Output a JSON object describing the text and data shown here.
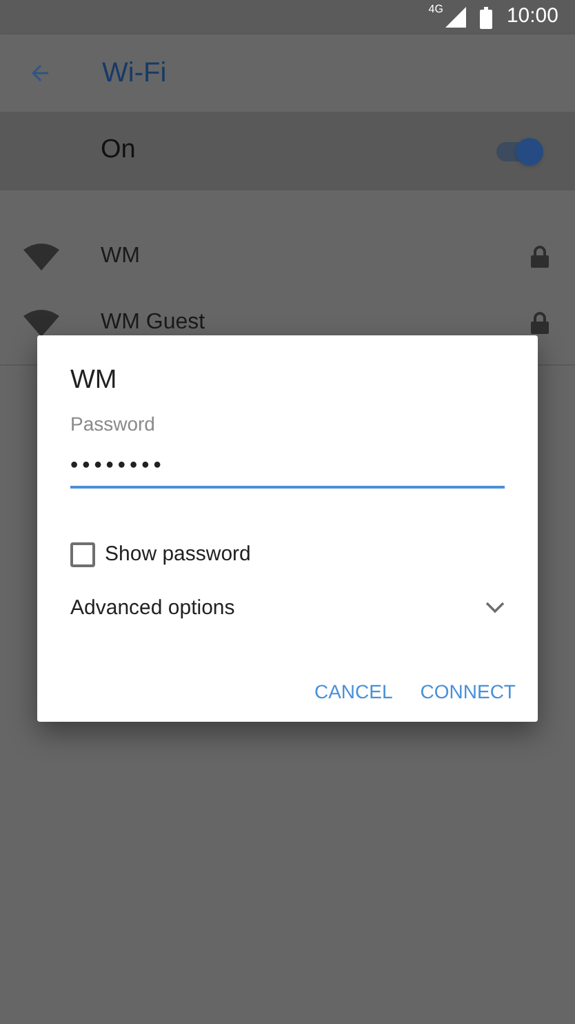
{
  "status_bar": {
    "network": "4G",
    "time": "10:00"
  },
  "app_bar": {
    "title": "Wi-Fi"
  },
  "master_switch": {
    "label": "On",
    "on": true
  },
  "networks": [
    {
      "name": "WM",
      "secured": true
    },
    {
      "name": "WM Guest",
      "secured": true
    }
  ],
  "dialog": {
    "title": "WM",
    "password_label": "Password",
    "password_value": "••••••••",
    "show_password": {
      "label": "Show password",
      "checked": false
    },
    "advanced": {
      "label": "Advanced options",
      "expanded": false
    },
    "buttons": [
      "CANCEL",
      "CONNECT"
    ]
  }
}
